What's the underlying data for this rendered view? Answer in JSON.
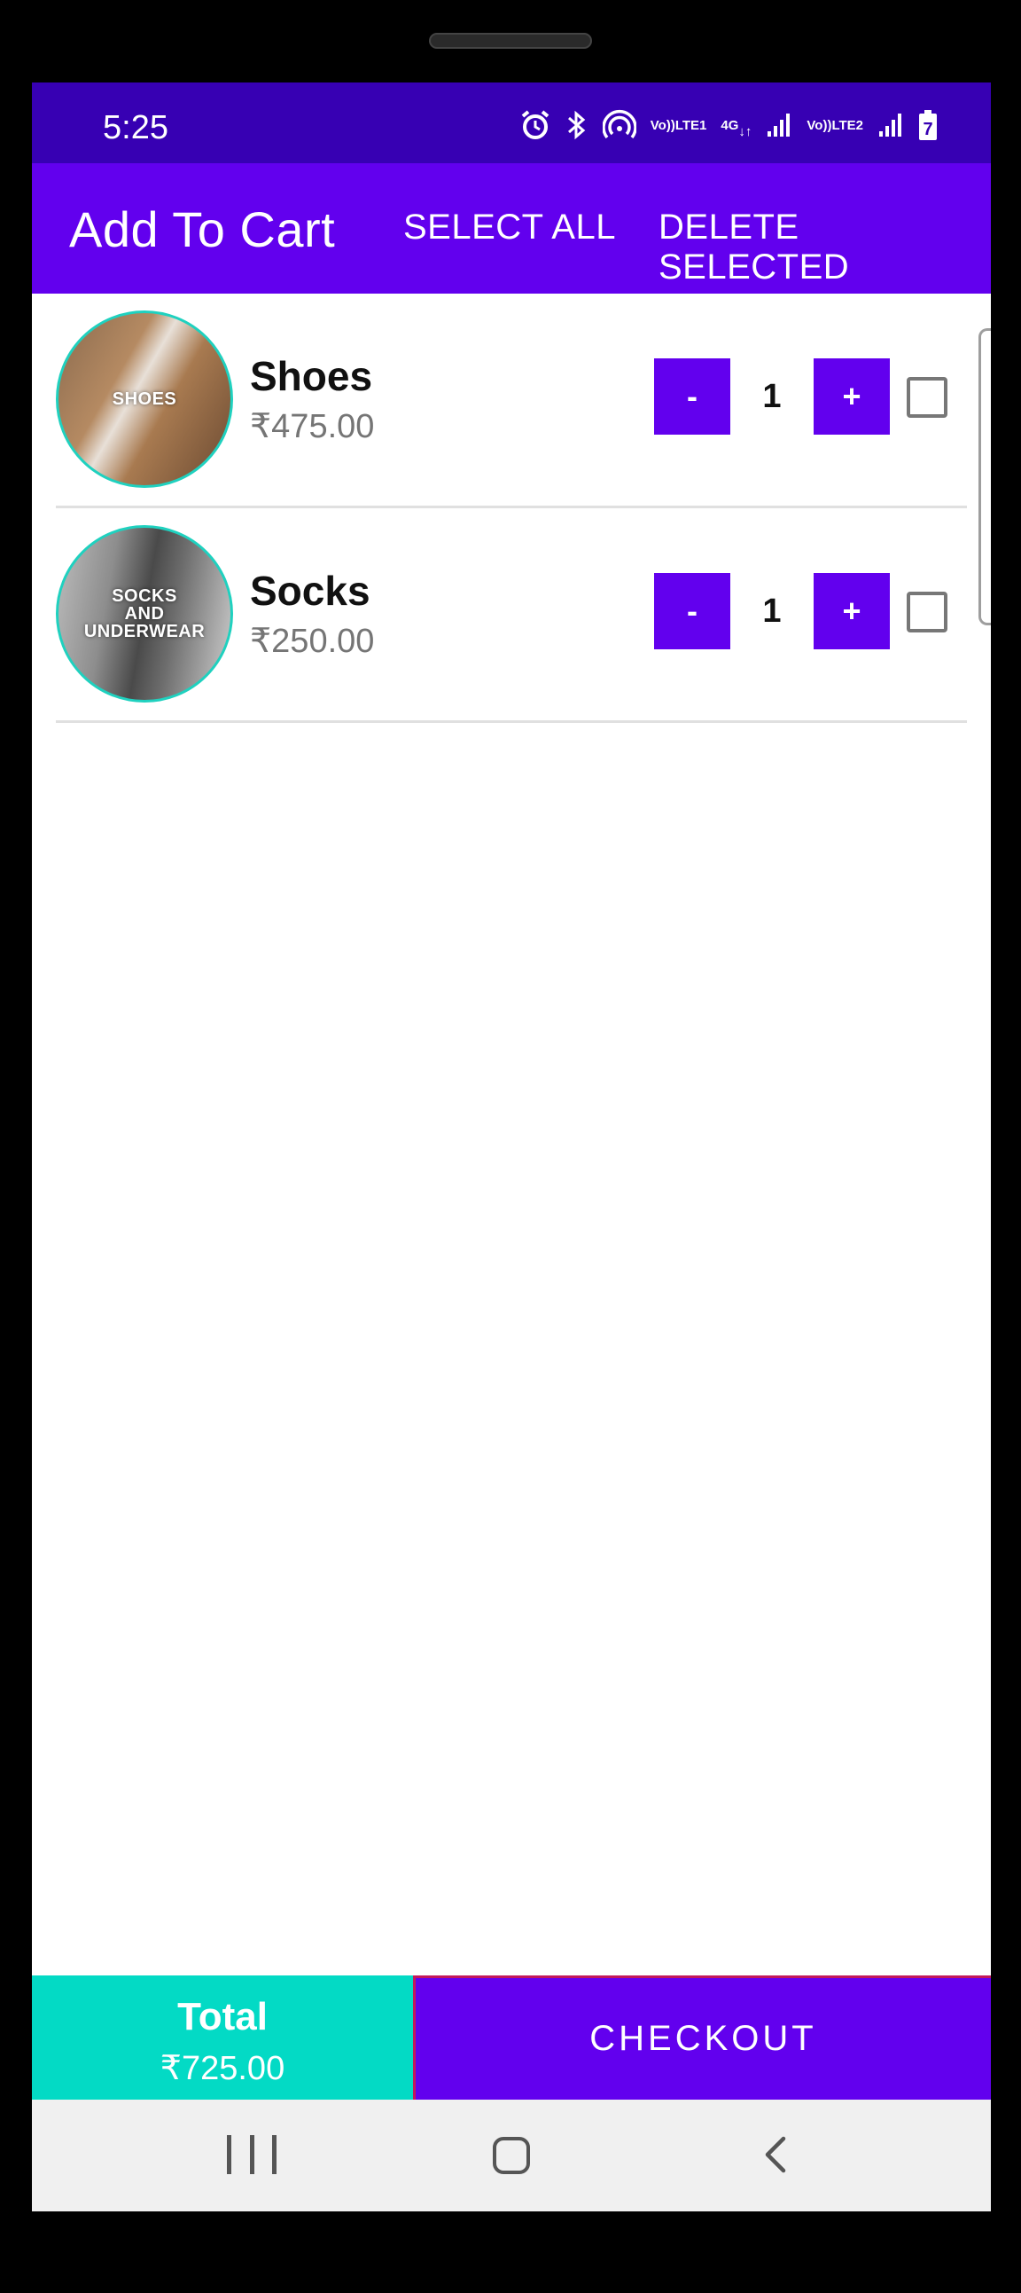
{
  "status_bar": {
    "time": "5:25",
    "icons": [
      "alarm-icon",
      "bluetooth-icon",
      "hotspot-icon",
      "volte-1-icon",
      "4g-icon",
      "signal-1-icon",
      "volte-2-icon",
      "signal-2-icon",
      "battery-charging-icon"
    ],
    "volte1_top": "Vo))",
    "volte1_bottom": "LTE1",
    "net_type": "4G",
    "volte2_top": "Vo))",
    "volte2_bottom": "LTE2",
    "battery_level": "7"
  },
  "app_bar": {
    "title": "Add To Cart",
    "select_all_label": "SELECT ALL",
    "delete_selected_label": "DELETE SELECTED"
  },
  "cart": {
    "items": [
      {
        "name": "Shoes",
        "price": "₹475.00",
        "quantity": "1",
        "image_label": "SHOES",
        "minus_label": "-",
        "plus_label": "+",
        "checked": false
      },
      {
        "name": "Socks",
        "price": "₹250.00",
        "quantity": "1",
        "image_label": "SOCKS\nAND\nUNDERWEAR",
        "minus_label": "-",
        "plus_label": "+",
        "checked": false
      }
    ]
  },
  "footer": {
    "total_label": "Total",
    "total_value": "₹725.00",
    "checkout_label": "CHECKOUT"
  },
  "colors": {
    "status_bar": "#3700B3",
    "primary": "#6200EE",
    "accent": "#03DAC5",
    "checkout_border": "#C2185B",
    "price_text": "#757575"
  }
}
